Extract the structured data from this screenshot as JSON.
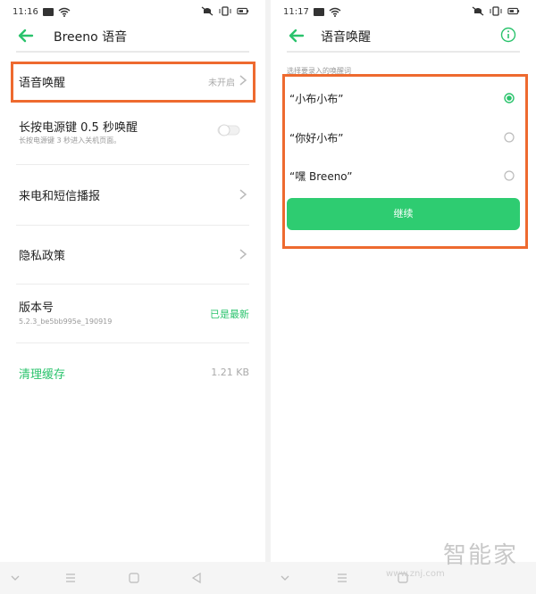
{
  "left": {
    "status": {
      "time": "11:16"
    },
    "title": "Breeno 语音",
    "rows": [
      {
        "title": "语音唤醒",
        "value": "未开启"
      },
      {
        "title": "长按电源键 0.5 秒唤醒",
        "subtitle": "长按电源键 3 秒进入关机页面。"
      },
      {
        "title": "来电和短信播报"
      },
      {
        "title": "隐私政策"
      },
      {
        "title": "版本号",
        "subtitle": "5.2.3_be5bb995e_190919",
        "value": "已是最新"
      },
      {
        "title": "清理缓存",
        "value": "1.21 KB"
      }
    ]
  },
  "right": {
    "status": {
      "time": "11:17"
    },
    "title": "语音唤醒",
    "hint": "选择要录入的唤醒词",
    "options": [
      {
        "label": "“小布小布”",
        "selected": true
      },
      {
        "label": "“你好小布”",
        "selected": false
      },
      {
        "label": "“嘿 Breeno”",
        "selected": false
      }
    ],
    "continue_label": "继续"
  },
  "watermark": {
    "brand": "智能家",
    "url": "www.znj.com"
  },
  "colors": {
    "accent": "#2ac36c",
    "highlight": "#ee6a2f"
  }
}
